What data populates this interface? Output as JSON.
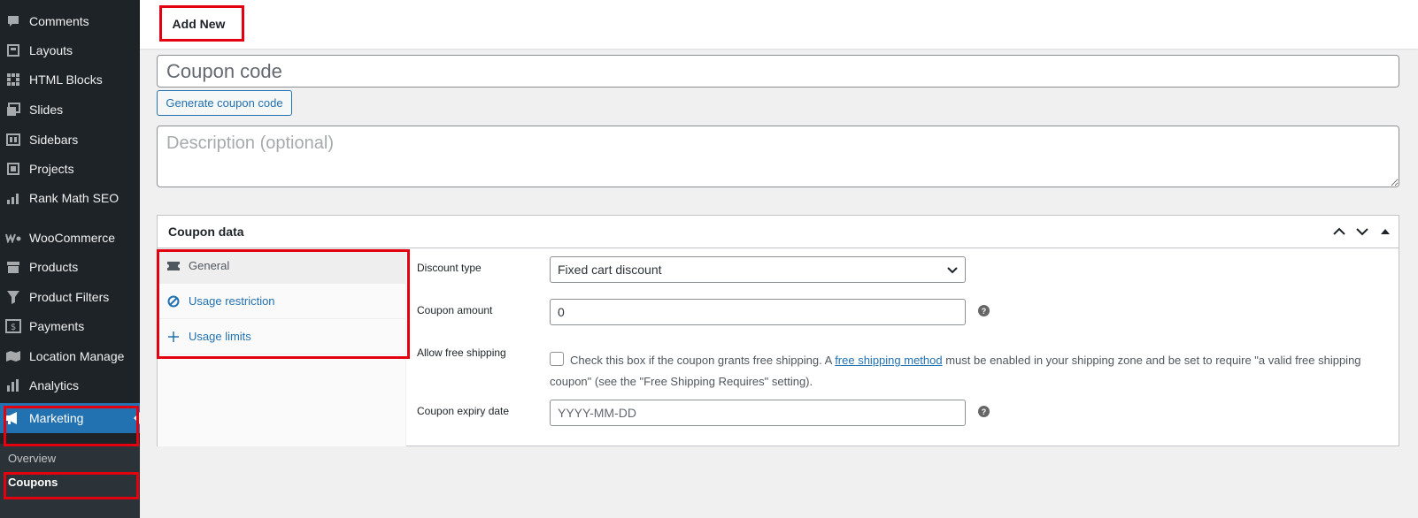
{
  "sidebar": {
    "items": [
      {
        "label": "Comments",
        "icon": "comment-icon"
      },
      {
        "label": "Layouts",
        "icon": "layouts-icon"
      },
      {
        "label": "HTML Blocks",
        "icon": "grid-icon"
      },
      {
        "label": "Slides",
        "icon": "slides-icon"
      },
      {
        "label": "Sidebars",
        "icon": "sidebars-icon"
      },
      {
        "label": "Projects",
        "icon": "projects-icon"
      },
      {
        "label": "Rank Math SEO",
        "icon": "chart-icon"
      },
      {
        "label": "WooCommerce",
        "icon": "woo-icon"
      },
      {
        "label": "Products",
        "icon": "archive-icon"
      },
      {
        "label": "Product Filters",
        "icon": "filter-icon"
      },
      {
        "label": "Payments",
        "icon": "dollar-icon"
      },
      {
        "label": "Location Manage",
        "icon": "map-icon"
      },
      {
        "label": "Analytics",
        "icon": "bar-chart-icon"
      },
      {
        "label": "Marketing",
        "icon": "megaphone-icon"
      }
    ],
    "submenu": [
      {
        "label": "Overview"
      },
      {
        "label": "Coupons"
      }
    ]
  },
  "header": {
    "add_new_label": "Add New"
  },
  "coupon": {
    "code_placeholder": "Coupon code",
    "generate_label": "Generate coupon code",
    "description_placeholder": "Description (optional)"
  },
  "panel": {
    "title": "Coupon data",
    "tabs": [
      {
        "label": "General"
      },
      {
        "label": "Usage restriction"
      },
      {
        "label": "Usage limits"
      }
    ],
    "fields": {
      "discount_type_label": "Discount type",
      "discount_type_value": "Fixed cart discount",
      "amount_label": "Coupon amount",
      "amount_value": "0",
      "free_shipping_label": "Allow free shipping",
      "free_shipping_text_1": "Check this box if the coupon grants free shipping. A ",
      "free_shipping_link": "free shipping method",
      "free_shipping_text_2": " must be enabled in your shipping zone and be set to require \"a valid free shipping coupon\" (see the \"Free Shipping Requires\" setting).",
      "expiry_label": "Coupon expiry date",
      "expiry_placeholder": "YYYY-MM-DD"
    }
  },
  "colors": {
    "accent": "#2271b1",
    "sidebar_bg": "#1d2327",
    "highlight": "#e3000f"
  }
}
